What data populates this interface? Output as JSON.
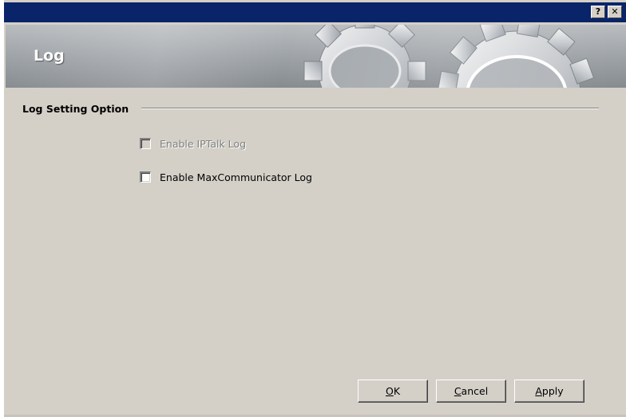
{
  "titlebar": {
    "help_label": "?",
    "close_label": "✕"
  },
  "banner": {
    "title": "Log",
    "graphic": "gears-image"
  },
  "section": {
    "label": "Log Setting Option"
  },
  "options": [
    {
      "label": "Enable IPTalk Log",
      "checked": false,
      "enabled": false
    },
    {
      "label": "Enable MaxCommunicator Log",
      "checked": false,
      "enabled": true
    }
  ],
  "buttons": {
    "ok": {
      "mnemonic": "O",
      "rest": "K"
    },
    "cancel": {
      "mnemonic": "C",
      "rest": "ancel"
    },
    "apply": {
      "mnemonic": "A",
      "rest": "pply"
    }
  },
  "colors": {
    "titlebar": "#0a246a",
    "dialog_bg": "#d4d0c8"
  }
}
